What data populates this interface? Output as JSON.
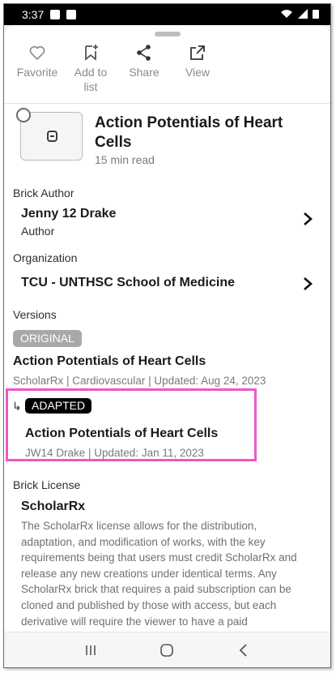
{
  "status": {
    "time": "3:37"
  },
  "actions": [
    {
      "label": "Favorite",
      "icon": "heart-icon"
    },
    {
      "label": "Add to list",
      "icon": "bookmark-add-icon"
    },
    {
      "label": "Share",
      "icon": "share-icon"
    },
    {
      "label": "View",
      "icon": "external-link-icon"
    }
  ],
  "brick": {
    "title": "Action Potentials of Heart Cells",
    "read_time": "15 min read"
  },
  "author": {
    "section": "Brick Author",
    "name": "Jenny 12 Drake",
    "role": "Author"
  },
  "organization": {
    "section": "Organization",
    "name": "TCU - UNTHSC School of Medicine"
  },
  "versions": {
    "section": "Versions",
    "original": {
      "badge": "ORIGINAL",
      "title": "Action Potentials of Heart Cells",
      "meta": "ScholarRx | Cardiovascular | Updated: Aug 24, 2023"
    },
    "adapted": {
      "arrow": "↳",
      "badge": "ADAPTED",
      "title": "Action Potentials of Heart Cells",
      "meta": "JW14 Drake | Updated: Jan 11, 2023"
    }
  },
  "license": {
    "section": "Brick License",
    "name": "ScholarRx",
    "text": "The ScholarRx license allows for the distribution, adaptation, and modification of works, with the key requirements being that users must credit ScholarRx and release any new creations under identical terms. Any ScholarRx brick that requires a paid subscription can be cloned and published by those with access, but each derivative will require the viewer to have a paid"
  },
  "colors": {
    "highlight": "#ee55cc",
    "badge_original": "#a8a8a8",
    "badge_adapted": "#000000"
  }
}
